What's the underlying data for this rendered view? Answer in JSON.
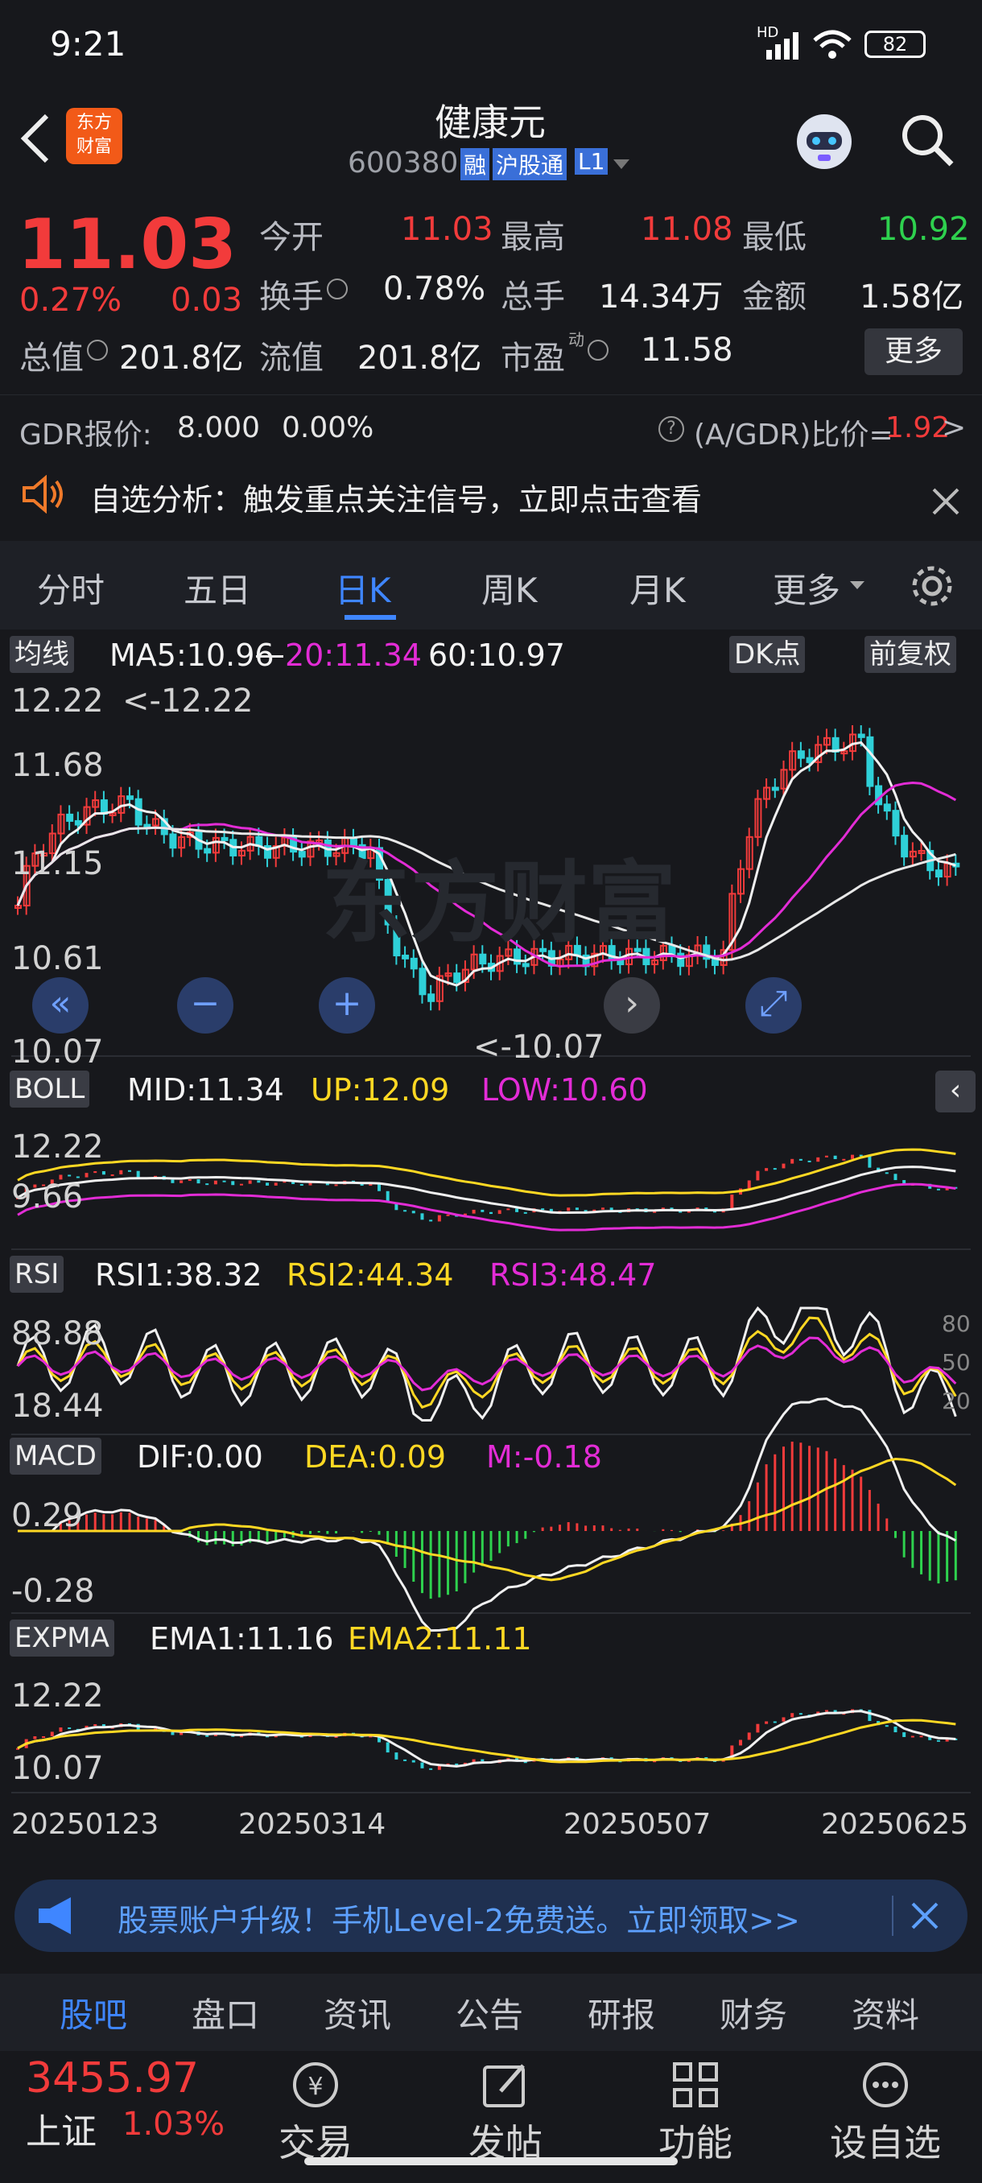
{
  "status": {
    "time": "9:21",
    "network": "HD",
    "battery": "82"
  },
  "header": {
    "title": "健康元",
    "code": "600380",
    "badge_rong": "融",
    "badge_hgt": "沪股通",
    "badge_level": "L1",
    "logo_line1": "东方",
    "logo_line2": "财富"
  },
  "quote": {
    "price": "11.03",
    "change_pct": "0.27%",
    "change": "0.03",
    "open_label": "今开",
    "open": "11.03",
    "high_label": "最高",
    "high": "11.08",
    "low_label": "最低",
    "low": "10.92",
    "turnover_label": "换手",
    "turnover": "0.78%",
    "volume_label": "总手",
    "volume": "14.34万",
    "amount_label": "金额",
    "amount": "1.58亿",
    "mcap_label": "总值",
    "mcap": "201.8亿",
    "float_label": "流值",
    "float": "201.8亿",
    "pe_label": "市盈",
    "pe_sup": "动",
    "pe": "11.58",
    "more_label": "更多"
  },
  "gdr": {
    "label": "GDR报价:",
    "price": "8.000",
    "pct": "0.00%",
    "ratio_label": "(A/GDR)比价=",
    "ratio": "1.92",
    "chev": ">"
  },
  "notice": {
    "text": "自选分析：触发重点关注信号，立即点击查看"
  },
  "tabs": {
    "items": [
      "分时",
      "五日",
      "日K",
      "周K",
      "月K"
    ],
    "more": "更多"
  },
  "chart": {
    "ma": {
      "selector": "均线",
      "ma5": "MA5:10.96",
      "ma20": "20:11.34",
      "ma60": "60:10.97",
      "dk": "DK点",
      "fq": "前复权",
      "yticks": [
        "12.22",
        "11.68",
        "11.15",
        "10.61",
        "10.07"
      ],
      "max_label": "<-12.22",
      "min_label": "<-10.07"
    },
    "boll": {
      "name": "BOLL",
      "mid": "MID:11.34",
      "up": "UP:12.09",
      "low": "LOW:10.60",
      "yticks": [
        "12.22",
        "9.66"
      ]
    },
    "rsi": {
      "name": "RSI",
      "rsi1": "RSI1:38.32",
      "rsi2": "RSI2:44.34",
      "rsi3": "RSI3:48.47",
      "yticks": [
        "88.88",
        "18.44"
      ],
      "right_ticks": [
        "80",
        "50",
        "20"
      ]
    },
    "macd": {
      "name": "MACD",
      "dif": "DIF:0.00",
      "dea": "DEA:0.09",
      "m": "M:-0.18",
      "yticks": [
        "0.29",
        "-0.28"
      ]
    },
    "expma": {
      "name": "EXPMA",
      "ema1": "EMA1:11.16",
      "ema2": "EMA2:11.11",
      "yticks": [
        "12.22",
        "10.07"
      ]
    },
    "dates": [
      "20250123",
      "20250314",
      "20250507",
      "20250625"
    ],
    "watermark": "东方财富"
  },
  "chart_data": {
    "type": "candlestick",
    "symbol": "600380",
    "xticks": [
      "20250123",
      "20250314",
      "20250507",
      "20250625"
    ],
    "high": 12.22,
    "low": 10.07,
    "indicators": {
      "MA5": 10.96,
      "MA20": 11.34,
      "MA60": 10.97,
      "BOLL_MID": 11.34,
      "BOLL_UP": 12.09,
      "BOLL_LOW": 10.6,
      "RSI1": 38.32,
      "RSI2": 44.34,
      "RSI3": 48.47,
      "DIF": 0.0,
      "DEA": 0.09,
      "M": -0.18,
      "EMA1": 11.16,
      "EMA2": 11.11
    }
  },
  "banner": {
    "text": "股票账户升级！手机Level-2免费送。立即领取>>"
  },
  "bottom_tabs": [
    "股吧",
    "盘口",
    "资讯",
    "公告",
    "研报",
    "财务",
    "资料"
  ],
  "footer": {
    "index_value": "3455.97",
    "index_name": "上证",
    "index_pct": "1.03%",
    "trade": "交易",
    "post": "发帖",
    "func": "功能",
    "custom": "设自选"
  }
}
